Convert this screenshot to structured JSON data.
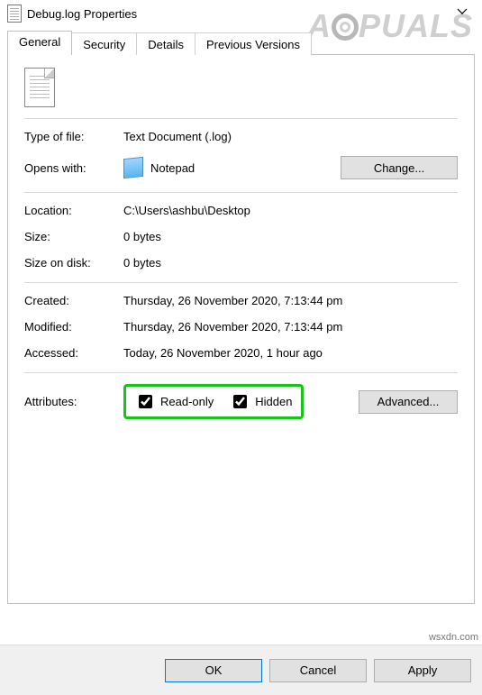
{
  "window": {
    "title": "Debug.log Properties"
  },
  "tabs": {
    "general": "General",
    "security": "Security",
    "details": "Details",
    "previous": "Previous Versions"
  },
  "labels": {
    "type_of_file": "Type of file:",
    "opens_with": "Opens with:",
    "location": "Location:",
    "size": "Size:",
    "size_on_disk": "Size on disk:",
    "created": "Created:",
    "modified": "Modified:",
    "accessed": "Accessed:",
    "attributes": "Attributes:"
  },
  "values": {
    "type_of_file": "Text Document (.log)",
    "opens_with": "Notepad",
    "location": "C:\\Users\\ashbu\\Desktop",
    "size": "0 bytes",
    "size_on_disk": "0 bytes",
    "created": "Thursday, 26 November 2020, 7:13:44 pm",
    "modified": "Thursday, 26 November 2020, 7:13:44 pm",
    "accessed": "Today, 26 November 2020, 1 hour ago"
  },
  "buttons": {
    "change": "Change...",
    "advanced": "Advanced...",
    "ok": "OK",
    "cancel": "Cancel",
    "apply": "Apply"
  },
  "attributes": {
    "read_only": "Read-only",
    "hidden": "Hidden"
  },
  "watermark": {
    "pre": "A",
    "post": "PUALS"
  },
  "source": "wsxdn.com"
}
